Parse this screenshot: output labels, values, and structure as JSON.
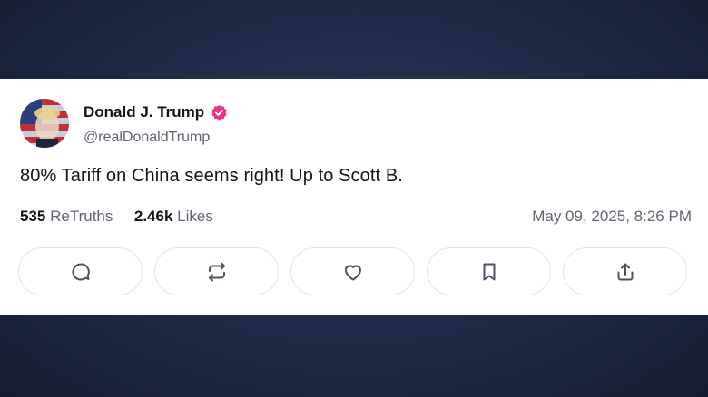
{
  "post": {
    "author_name": "Donald J. Trump",
    "author_handle": "@realDonaldTrump",
    "text": "80% Tariff on China seems right! Up to Scott B.",
    "retruths_count": "535",
    "retruths_label": "ReTruths",
    "likes_count": "2.46k",
    "likes_label": "Likes",
    "timestamp": "May 09, 2025, 8:26 PM"
  },
  "actions": [
    {
      "name": "reply",
      "icon": "comment-icon"
    },
    {
      "name": "retruth",
      "icon": "repost-icon"
    },
    {
      "name": "like",
      "icon": "heart-icon"
    },
    {
      "name": "bookmark",
      "icon": "bookmark-icon"
    },
    {
      "name": "share",
      "icon": "share-icon"
    }
  ],
  "colors": {
    "background": "#1f2946",
    "card": "#ffffff",
    "verified_badge": "#e8318a",
    "text_primary": "#111418",
    "text_secondary": "#5f6673"
  }
}
